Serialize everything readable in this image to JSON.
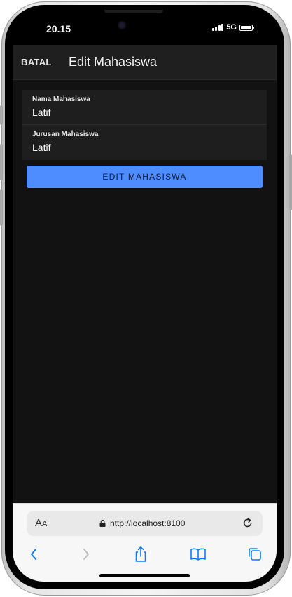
{
  "status_bar": {
    "time": "20.15",
    "network": "5G"
  },
  "toolbar": {
    "cancel_label": "BATAL",
    "title": "Edit Mahasiswa"
  },
  "form": {
    "fields": [
      {
        "label": "Nama Mahasiswa",
        "value": "Latif"
      },
      {
        "label": "Jurusan Mahasiswa",
        "value": "Latif"
      }
    ],
    "submit_label": "EDIT MAHASISWA"
  },
  "browser": {
    "reader_label_large": "A",
    "reader_label_small": "A",
    "url": "http://localhost:8100",
    "icons": [
      "back-chevron-icon",
      "forward-chevron-icon",
      "share-icon",
      "bookmarks-icon",
      "tabs-icon",
      "reload-icon",
      "lock-icon"
    ]
  },
  "colors": {
    "background": "#121212",
    "toolbar": "#1f1f1f",
    "accent": "#4d8dff",
    "ios_blue": "#0a7aff"
  }
}
